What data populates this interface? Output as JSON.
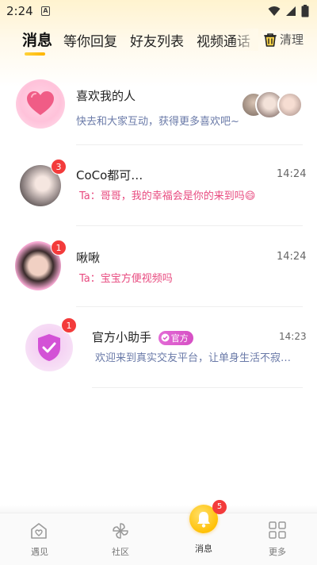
{
  "status_bar": {
    "time": "2:24",
    "notification_letter": "A"
  },
  "tabs": {
    "items": [
      {
        "label": "消息",
        "active": true
      },
      {
        "label": "等你回复",
        "active": false
      },
      {
        "label": "好友列表",
        "active": false
      },
      {
        "label": "视频通话",
        "active": false
      }
    ],
    "clear_label": "清理"
  },
  "likes": {
    "title": "喜欢我的人",
    "subtitle": "快去和大家互动，获得更多喜欢吧~"
  },
  "conversations": [
    {
      "name": "CoCo都可…",
      "time": "14:24",
      "message": "Ta：哥哥，我的幸福会是你的来到吗😄",
      "unread": "3"
    },
    {
      "name": "啾啾",
      "time": "14:24",
      "message": "Ta：宝宝方便视频吗",
      "unread": "1"
    },
    {
      "name": "官方小助手",
      "tag": "官方",
      "time": "14:23",
      "message": "欢迎来到真实交友平台，让单身生活不寂…",
      "unread": "1"
    }
  ],
  "bottom_nav": {
    "items": [
      {
        "label": "遇见",
        "icon": "home-heart-icon"
      },
      {
        "label": "社区",
        "icon": "pinwheel-icon"
      },
      {
        "label": "消息",
        "icon": "bell-icon",
        "active": true,
        "badge": "5"
      },
      {
        "label": "更多",
        "icon": "grid-icon"
      }
    ]
  },
  "colors": {
    "accent": "#ffc107",
    "badge": "#f33b3b",
    "message_pink": "#e84a7f",
    "official_purple": "#d64fc4"
  }
}
